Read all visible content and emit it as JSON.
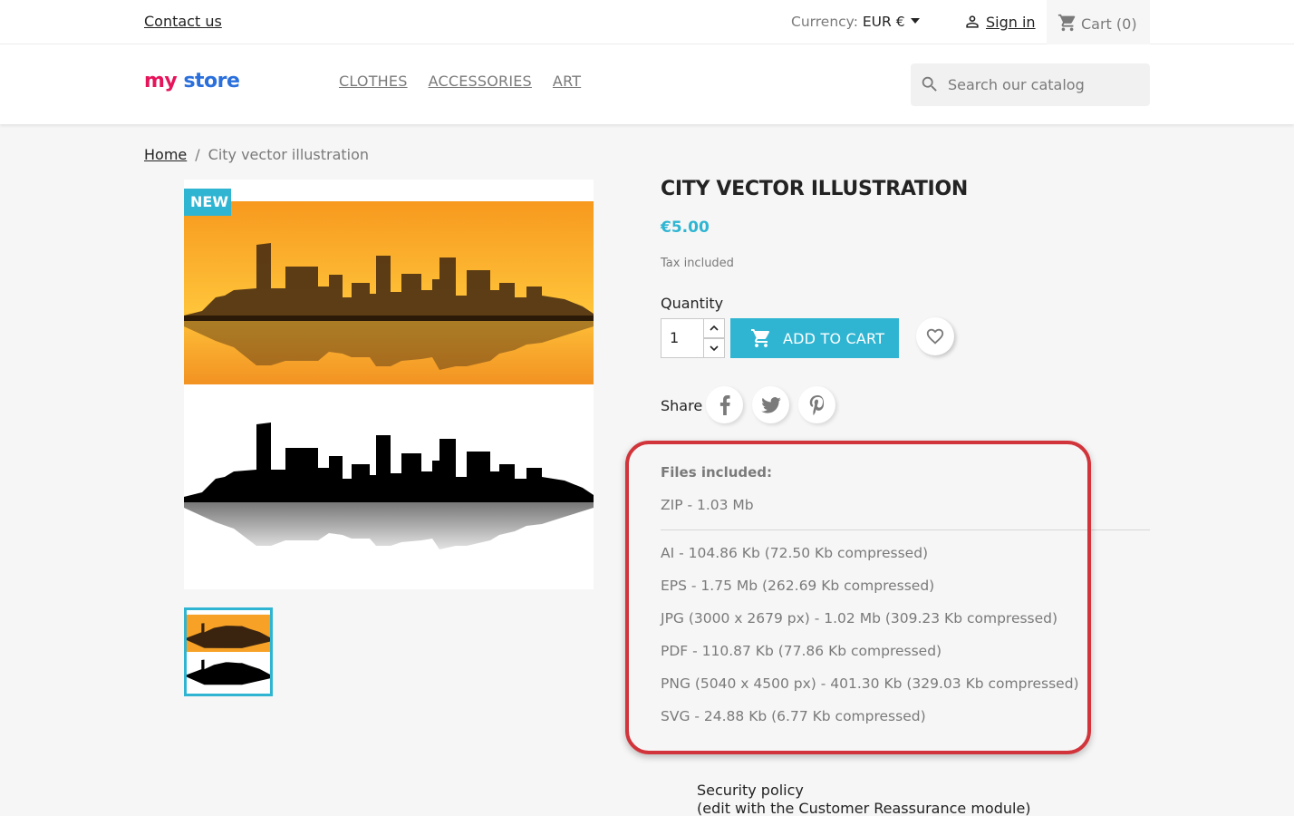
{
  "topbar": {
    "contact_label": "Contact us",
    "currency_label": "Currency:",
    "currency_value": "EUR €",
    "signin_label": "Sign in",
    "cart_label": "Cart",
    "cart_count": "(0)"
  },
  "header": {
    "logo_part1": "my",
    "logo_part2": "store",
    "menu": [
      "CLOTHES",
      "ACCESSORIES",
      "ART"
    ],
    "search_placeholder": "Search our catalog"
  },
  "breadcrumb": {
    "home": "Home",
    "separator": "/",
    "current": "City vector illustration"
  },
  "product": {
    "badge": "NEW",
    "title": "CITY VECTOR ILLUSTRATION",
    "price": "€5.00",
    "tax_note": "Tax included",
    "quantity_label": "Quantity",
    "quantity_value": "1",
    "add_to_cart_label": "ADD TO CART",
    "share_label": "Share"
  },
  "files": {
    "heading": "Files included:",
    "archive": "ZIP - 1.03 Mb",
    "items": [
      "AI - 104.86 Kb (72.50 Kb compressed)",
      "EPS - 1.75 Mb (262.69 Kb compressed)",
      "JPG (3000 x 2679 px) - 1.02 Mb (309.23 Kb compressed)",
      "PDF - 110.87 Kb (77.86 Kb compressed)",
      "PNG (5040 x 4500 px) - 401.30 Kb (329.03 Kb compressed)",
      "SVG - 24.88 Kb (6.77 Kb compressed)"
    ]
  },
  "reassurance": {
    "line1": "Security policy",
    "line2": "(edit with the Customer Reassurance module)"
  },
  "colors": {
    "accent": "#2fb5d2",
    "highlight_border": "#d1343a",
    "muted_text": "#7a7a7a",
    "sunset_top": "#ff9a1f",
    "sunset_bottom": "#f58a14"
  },
  "icons": [
    "person-icon",
    "cart-icon",
    "search-icon",
    "cart-add-icon",
    "heart-icon",
    "facebook-icon",
    "twitter-icon",
    "pinterest-icon",
    "chevron-up-icon",
    "chevron-down-icon",
    "caret-down-icon"
  ]
}
